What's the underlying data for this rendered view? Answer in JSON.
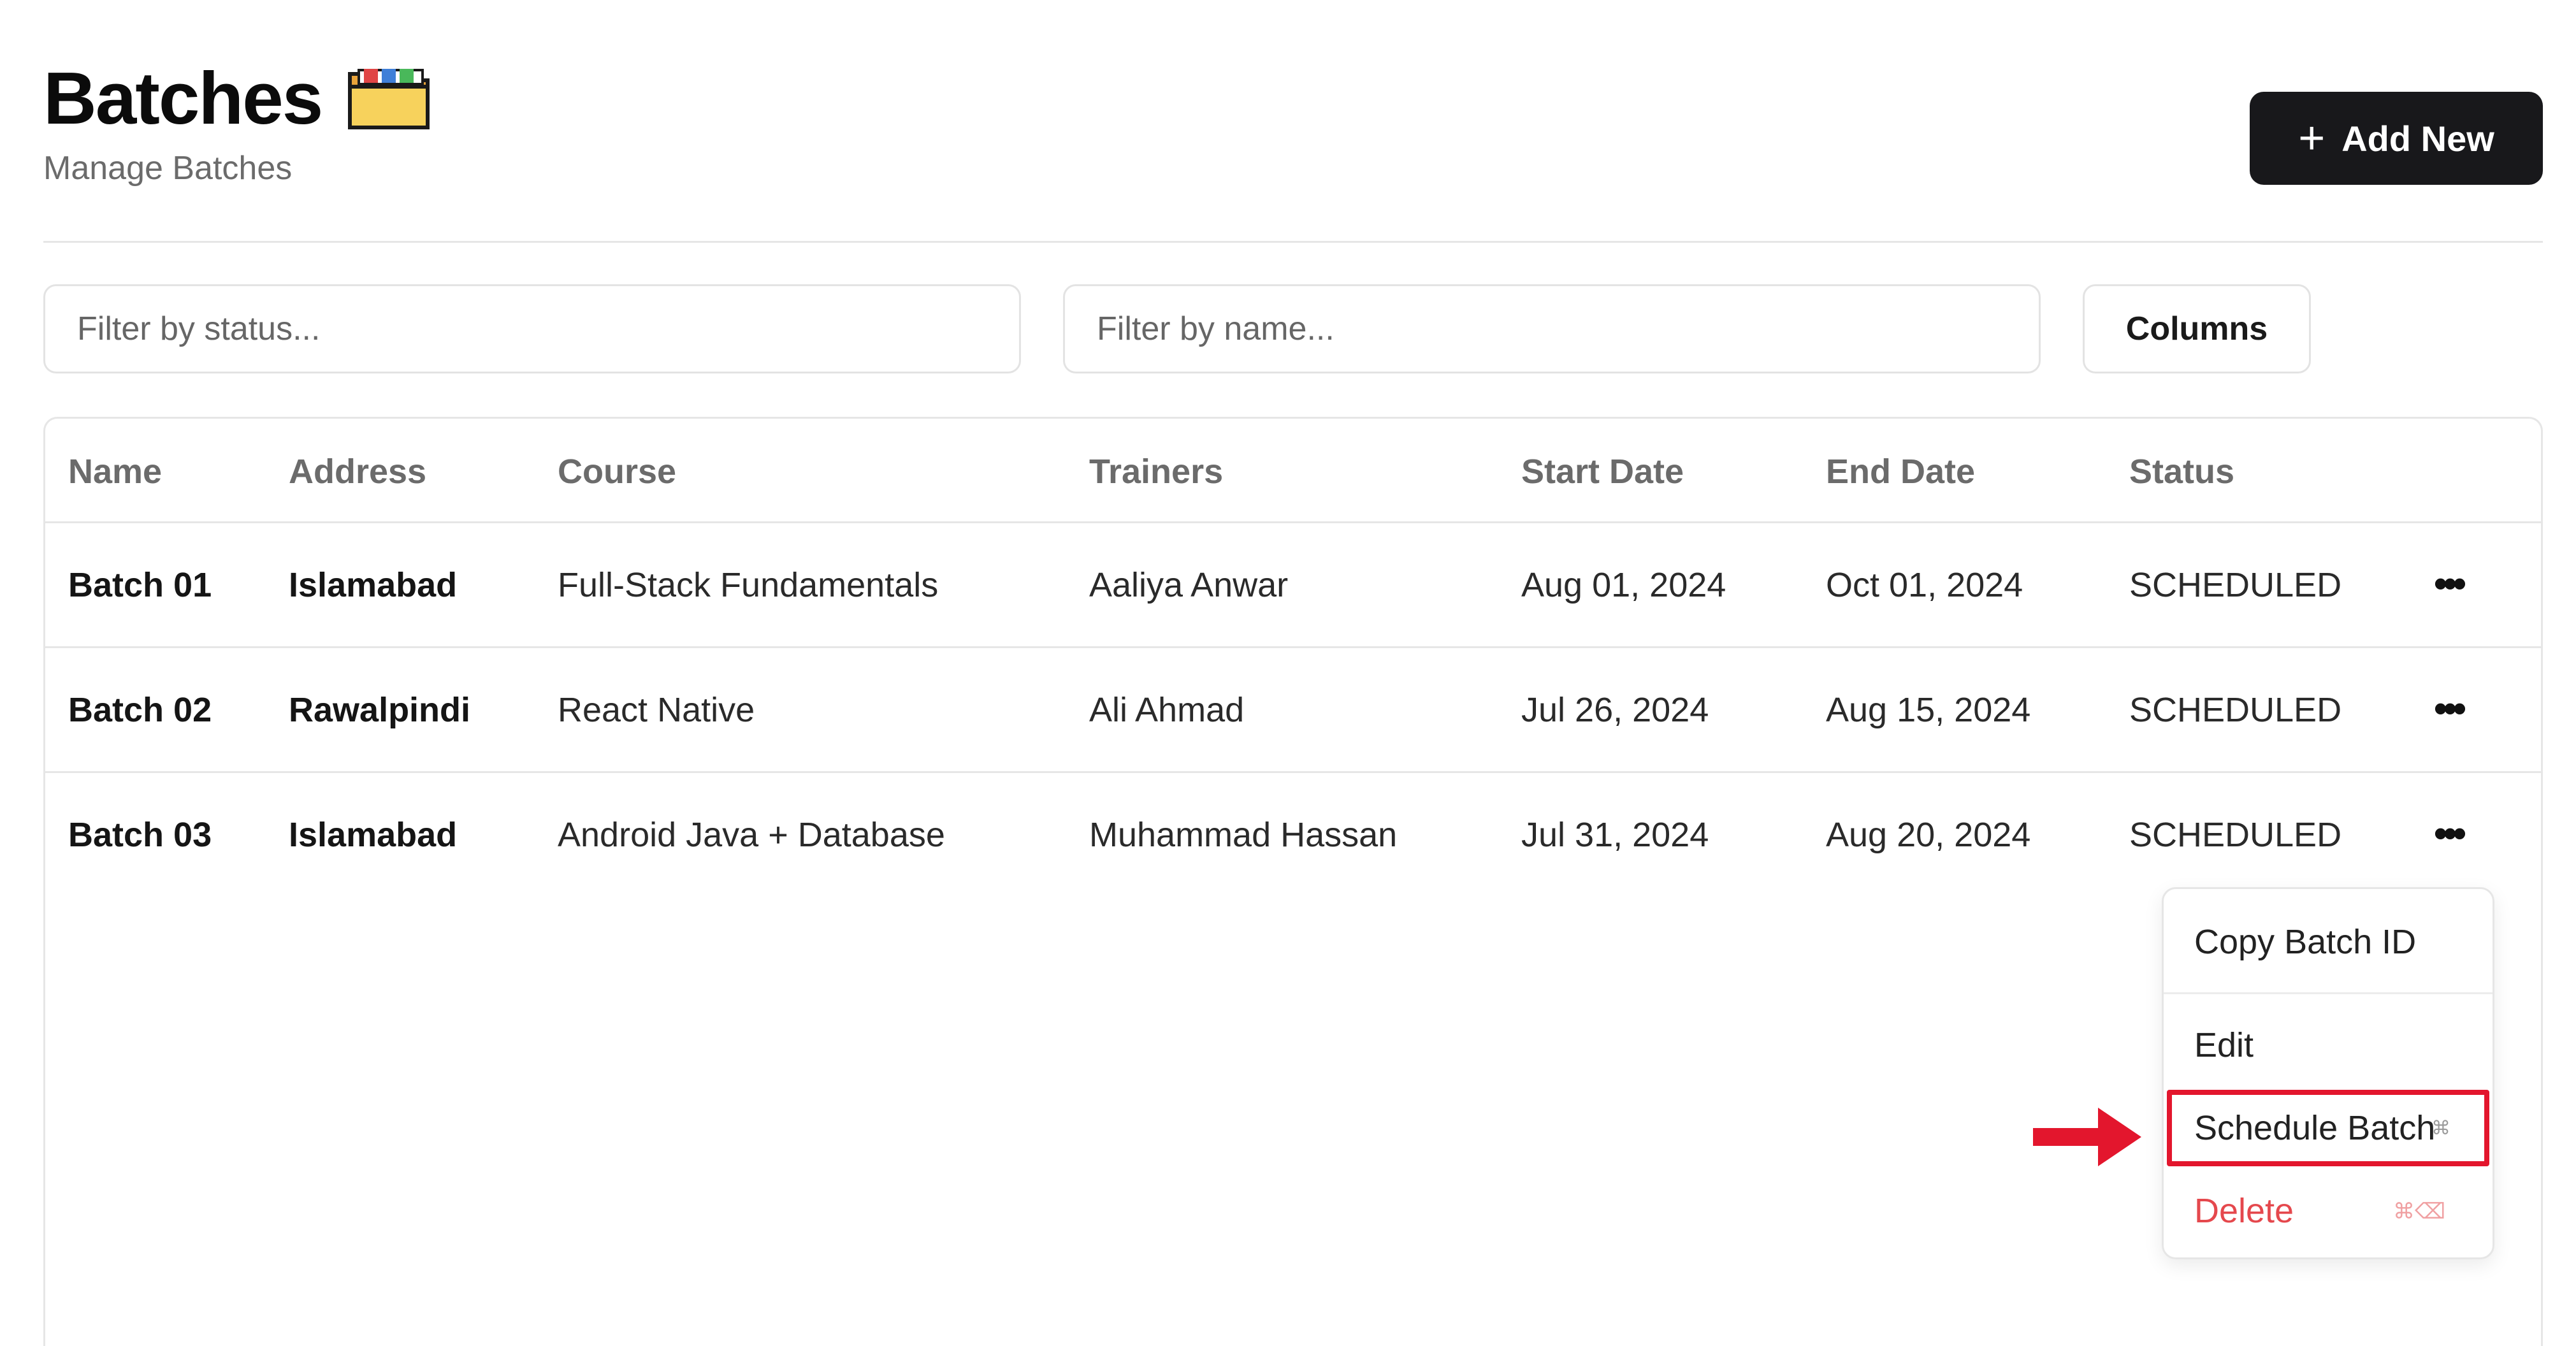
{
  "header": {
    "title": "Batches",
    "title_icon": "folder-icon",
    "subtitle": "Manage Batches",
    "add_button_label": "Add New",
    "add_button_icon": "plus-icon"
  },
  "filters": {
    "status_placeholder": "Filter by status...",
    "name_placeholder": "Filter by name...",
    "columns_label": "Columns"
  },
  "table": {
    "headers": [
      "Name",
      "Address",
      "Course",
      "Trainers",
      "Start Date",
      "End Date",
      "Status"
    ],
    "rows": [
      {
        "name": "Batch 01",
        "address": "Islamabad",
        "course": "Full-Stack Fundamentals",
        "trainers": "Aaliya Anwar",
        "start_date": "Aug 01, 2024",
        "end_date": "Oct 01, 2024",
        "status": "SCHEDULED"
      },
      {
        "name": "Batch 02",
        "address": "Rawalpindi",
        "course": "React Native",
        "trainers": "Ali Ahmad",
        "start_date": "Jul 26, 2024",
        "end_date": "Aug 15, 2024",
        "status": "SCHEDULED"
      },
      {
        "name": "Batch 03",
        "address": "Islamabad",
        "course": "Android Java + Database",
        "trainers": "Muhammad Hassan",
        "start_date": "Jul 31, 2024",
        "end_date": "Aug 20, 2024",
        "status": "SCHEDULED"
      }
    ]
  },
  "menu": {
    "copy_label": "Copy Batch ID",
    "edit_label": "Edit",
    "schedule_label": "Schedule Batch",
    "schedule_shortcut": "⌘",
    "delete_label": "Delete",
    "delete_shortcut": "⌘⌫"
  },
  "colors": {
    "primary_button": "#18181b",
    "delete_text": "#e5484d",
    "annotation_red": "#e3162d"
  }
}
